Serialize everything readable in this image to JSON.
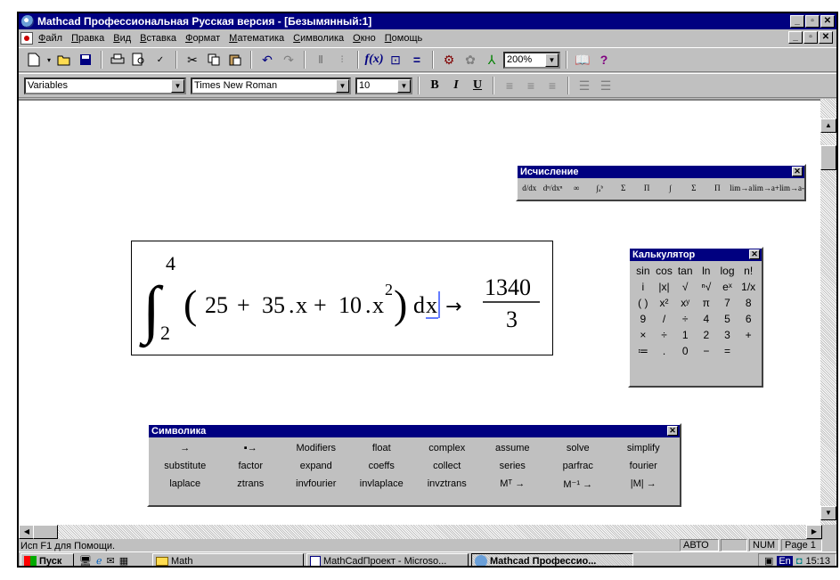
{
  "window": {
    "title": "Mathcad Профессиональная Русская версия - [Безымянный:1]"
  },
  "menu": [
    "Файл",
    "Правка",
    "Вид",
    "Вставка",
    "Формат",
    "Математика",
    "Символика",
    "Окно",
    "Помощь"
  ],
  "toolbar": {
    "zoom": "200%"
  },
  "format_bar": {
    "style": "Variables",
    "font": "Times New Roman",
    "size": "10",
    "bold": "B",
    "italic": "I",
    "underline": "U"
  },
  "calculus_palette": {
    "title": "Исчисление",
    "items": [
      "d/dx",
      "dⁿ/dxⁿ",
      "∞",
      "∫ₐᵇ",
      "Σ",
      "Π",
      "∫",
      "Σ",
      "Π",
      "lim→a",
      "lim→a+",
      "lim→a-"
    ]
  },
  "calculator_palette": {
    "title": "Калькулятор",
    "items": [
      "sin",
      "cos",
      "tan",
      "ln",
      "log",
      "n!",
      "i",
      "|x|",
      "√",
      "ⁿ√",
      "eˣ",
      "1/x",
      "( )",
      "x²",
      "xʸ",
      "π",
      "7",
      "8",
      "9",
      "/",
      "÷",
      "4",
      "5",
      "6",
      "×",
      "÷",
      "1",
      "2",
      "3",
      "+",
      "≔",
      ".",
      "0",
      "−",
      "="
    ]
  },
  "equation": {
    "lower": "2",
    "upper": "4",
    "c0": "25",
    "c1": "35",
    "c2": "10",
    "var": "x",
    "exp": "2",
    "num": "1340",
    "den": "3"
  },
  "symbolic_palette": {
    "title": "Символика",
    "items": [
      "→",
      "▪→",
      "Modifiers",
      "float",
      "complex",
      "assume",
      "solve",
      "simplify",
      "substitute",
      "factor",
      "expand",
      "coeffs",
      "collect",
      "series",
      "parfrac",
      "fourier",
      "laplace",
      "ztrans",
      "invfourier",
      "invlaplace",
      "invztrans",
      "Mᵀ →",
      "M⁻¹ →",
      "|M| →"
    ]
  },
  "status": {
    "help": "Исп F1 для Помощи.",
    "mode": "АВТО",
    "num": "NUM",
    "page": "Page 1"
  },
  "taskbar": {
    "start": "Пуск",
    "folder": "Math",
    "word": "MathCadПроект - Microso...",
    "app": "Mathcad Профессио...",
    "lang": "En",
    "time": "15:13"
  }
}
